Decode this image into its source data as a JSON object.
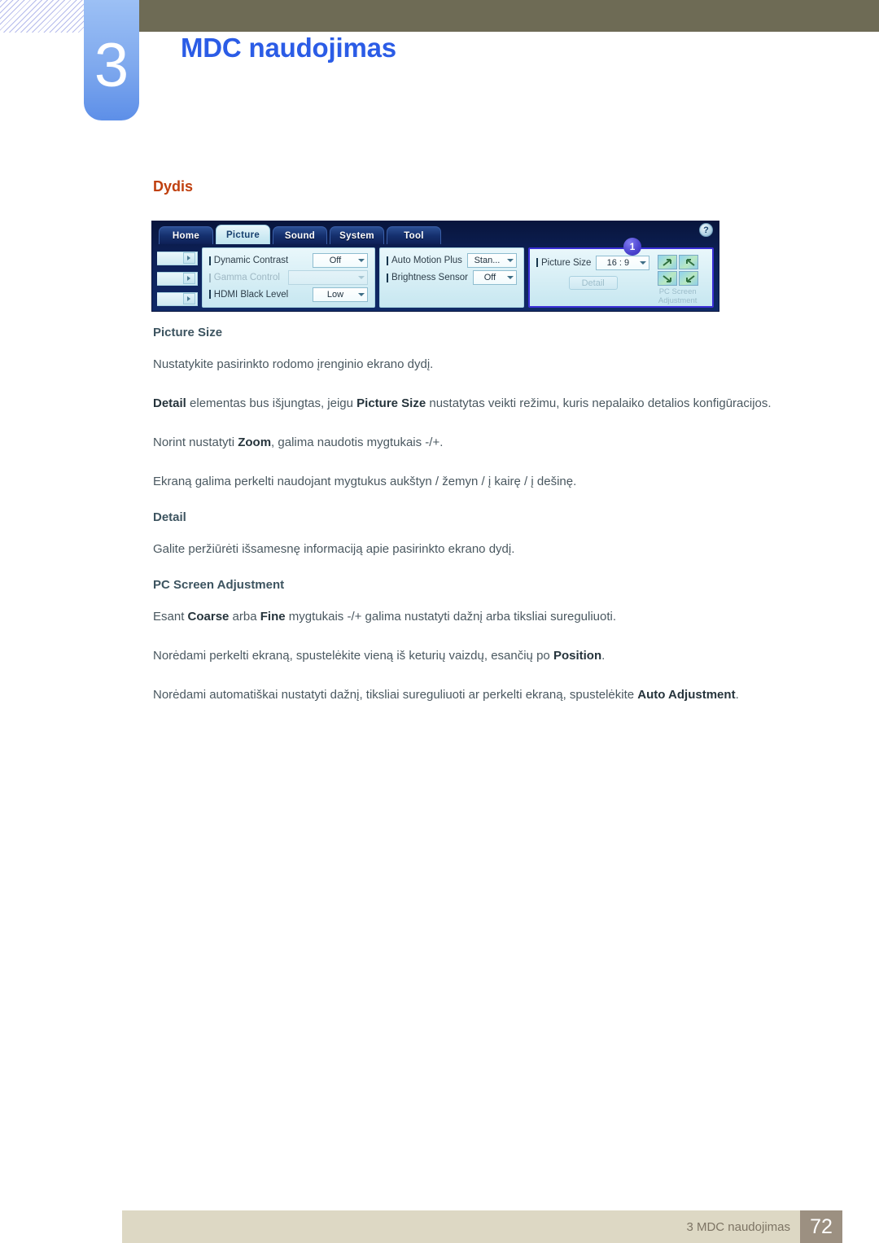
{
  "header": {
    "chapter_number": "3",
    "chapter_title": "MDC naudojimas"
  },
  "section": {
    "heading": "Dydis"
  },
  "mdc_app": {
    "tabs": [
      {
        "label": "Home",
        "active": false
      },
      {
        "label": "Picture",
        "active": true
      },
      {
        "label": "Sound",
        "active": false
      },
      {
        "label": "System",
        "active": false
      },
      {
        "label": "Tool",
        "active": false
      }
    ],
    "help_icon_label": "?",
    "callout_badge": "1",
    "column_a": [
      {
        "label": "Dynamic Contrast",
        "value": "Off",
        "disabled": false
      },
      {
        "label": "Gamma Control",
        "value": "",
        "disabled": true
      },
      {
        "label": "HDMI Black Level",
        "value": "Low",
        "disabled": false
      }
    ],
    "column_b": [
      {
        "label": "Auto Motion Plus",
        "value": "Stan...",
        "disabled": false
      },
      {
        "label": "Brightness Sensor",
        "value": "Off",
        "disabled": false
      }
    ],
    "column_c": {
      "picture_size_label": "Picture Size",
      "picture_size_value": "16 : 9",
      "detail_button": "Detail",
      "pc_screen_adjustment_label": "PC Screen\nAdjustment",
      "pc_screen_adjustment_line1": "PC Screen",
      "pc_screen_adjustment_line2": "Adjustment"
    },
    "highlight_color": "#3a2fd8"
  },
  "body": {
    "picture_size_heading": "Picture Size",
    "picture_size_p1": "Nustatykite pasirinkto rodomo įrenginio ekrano dydį.",
    "picture_size_p2_pre": "",
    "picture_size_p2_b1": "Detail",
    "picture_size_p2_mid": " elementas bus išjungtas, jeigu ",
    "picture_size_p2_b2": "Picture Size",
    "picture_size_p2_post": " nustatytas veikti režimu, kuris nepalaiko detalios konfigūracijos.",
    "picture_size_p3_pre": "Norint nustatyti ",
    "picture_size_p3_b1": "Zoom",
    "picture_size_p3_post": ", galima naudotis mygtukais -/+.",
    "picture_size_p4": "Ekraną galima perkelti naudojant mygtukus aukštyn / žemyn / į kairę / į dešinę.",
    "detail_heading": "Detail",
    "detail_p1": "Galite peržiūrėti išsamesnę informaciją apie pasirinkto ekrano dydį.",
    "pcsa_heading": "PC Screen Adjustment",
    "pcsa_p1_pre": "Esant ",
    "pcsa_p1_b1": "Coarse",
    "pcsa_p1_mid": " arba ",
    "pcsa_p1_b2": "Fine",
    "pcsa_p1_post": " mygtukais -/+ galima nustatyti dažnį arba tiksliai sureguliuoti.",
    "pcsa_p2_pre": "Norėdami perkelti ekraną, spustelėkite vieną iš keturių vaizdų, esančių po ",
    "pcsa_p2_b1": "Position",
    "pcsa_p2_post": ".",
    "pcsa_p3_pre": "Norėdami automatiškai nustatyti dažnį, tiksliai sureguliuoti ar perkelti ekraną, spustelėkite ",
    "pcsa_p3_b1": "Auto Adjustment",
    "pcsa_p3_post": "."
  },
  "footer": {
    "text": "3 MDC naudojimas",
    "page_number": "72"
  }
}
